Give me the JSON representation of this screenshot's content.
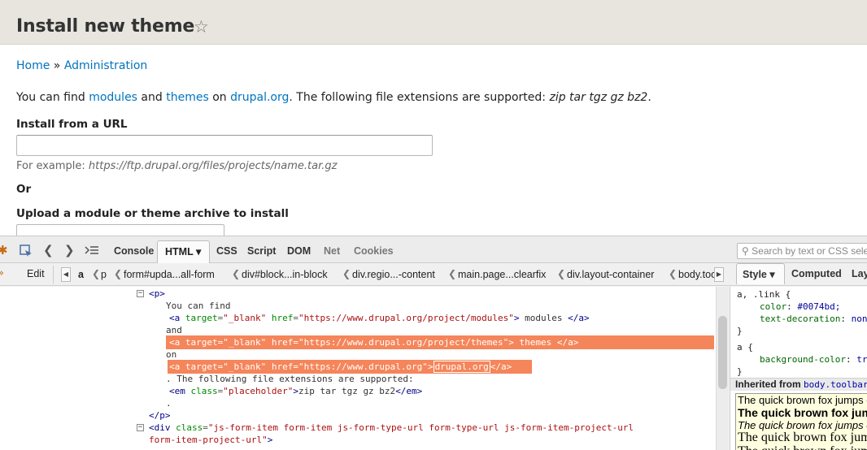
{
  "page": {
    "title": "Install new theme",
    "star": "☆",
    "breadcrumb": [
      "Home",
      "»",
      "Administration"
    ],
    "intro": {
      "t1": "You can find ",
      "modules": "modules",
      "t2": " and ",
      "themes": "themes",
      "t3": " on ",
      "drupal": "drupal.org",
      "t4": ". The following file extensions are supported: ",
      "exts": "zip tar tgz gz bz2",
      "t5": "."
    },
    "url_label": "Install from a URL",
    "url_value": "",
    "url_desc_prefix": "For example: ",
    "url_desc_example": "https://ftp.drupal.org/files/projects/name.tar.gz",
    "or_label": "Or",
    "upload_label": "Upload a module or theme archive to install"
  },
  "devtools": {
    "tabs": [
      "Console",
      "HTML ▾",
      "CSS",
      "Script",
      "DOM",
      "Net",
      "Cookies"
    ],
    "search_placeholder": "Search by text or CSS selector",
    "edit_label": "Edit",
    "crumbs": [
      "a",
      "p",
      "form#upda...all-form",
      "div#block...in-block",
      "div.regio...-content",
      "main.page...clearfix",
      "div.layout-container",
      "body.toolbar"
    ],
    "side_tabs": [
      "Style ▾",
      "Computed",
      "Layout"
    ],
    "html_lines": {
      "p_open": "<p>",
      "text1": "You can find",
      "a1_open": "<a",
      "a1_attr1": "target",
      "a1_val1": "\"_blank\"",
      "a1_attr2": "href",
      "a1_val2": "\"https://www.drupal.org/project/modules\"",
      "a1_text": "modules",
      "a_close": "</a>",
      "text_and": "and",
      "a2_val2": "\"https://www.drupal.org/project/themes\"",
      "a2_text": "themes",
      "text_on": "on",
      "a3_val2": "\"https://www.drupal.org\"",
      "a3_text": "drupal.org",
      "text2": ". The following file extensions are supported:",
      "em_open": "<em",
      "em_attr": "class",
      "em_val": "\"placeholder\"",
      "em_text": "zip tar tgz gz bz2",
      "em_close": "</em>",
      "dot": ".",
      "p_close": "</p>",
      "div_open": "<div",
      "div_attr": "class",
      "div_val1": "\"js-form-item form-item js-form-type-url form-type-url js-form-item-project-url",
      "div_val2": "form-item-project-url\"",
      "gt": ">",
      "eq": "="
    },
    "style_rules": {
      "rule1_sel": "a, .link {",
      "rule1_p1": "color",
      "rule1_v1": "#0074bd;",
      "rule1_p2": "text-decoration",
      "rule1_v2": "none;",
      "close": "}",
      "rule2_sel": "a {",
      "rule2_p1": "background-color",
      "rule2_v1": "transparent;",
      "inherited": "Inherited from ",
      "inherited_sel": "body.toolbar",
      "sample": "The quick brown fox jumps over the lazy dog"
    }
  },
  "colors": {
    "link": "#0074bd",
    "highlight": "#f5855a",
    "header_bg": "#e7e5de"
  }
}
